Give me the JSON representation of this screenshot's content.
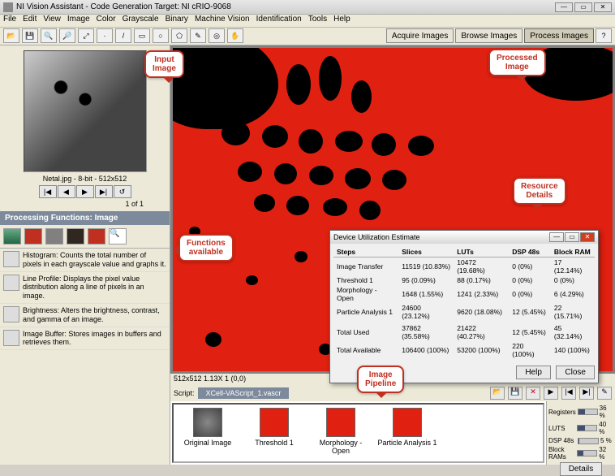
{
  "titlebar": {
    "title": "NI Vision Assistant - Code Generation Target: NI cRIO-9068"
  },
  "menubar": [
    "File",
    "Edit",
    "View",
    "Image",
    "Color",
    "Grayscale",
    "Binary",
    "Machine Vision",
    "Identification",
    "Tools",
    "Help"
  ],
  "top_tabs": {
    "acquire": "Acquire Images",
    "browse": "Browse Images",
    "process": "Process Images"
  },
  "thumb": {
    "caption": "Netal.jpg - 8-bit - 512x512",
    "count": "1 of 1"
  },
  "proc_header": "Processing Functions: Image",
  "functions": [
    {
      "icon": "hist",
      "text": "Histogram: Counts the total number of pixels in each grayscale value and graphs it."
    },
    {
      "icon": "line",
      "text": "Line Profile: Displays the pixel value distribution along a line of pixels in an image."
    },
    {
      "icon": "bright",
      "text": "Brightness: Alters the brightness, contrast, and gamma of an image."
    },
    {
      "icon": "buf",
      "text": "Image Buffer: Stores images in buffers and retrieves them."
    }
  ],
  "status": "512x512 1.13X 1 (0,0)",
  "script": "XCell-VAScript_1.vascr",
  "script_label": "Script:",
  "pipeline": [
    {
      "label": "Original Image",
      "cls": "orig"
    },
    {
      "label": "Threshold 1",
      "cls": ""
    },
    {
      "label": "Morphology - Open",
      "cls": ""
    },
    {
      "label": "Particle Analysis 1",
      "cls": ""
    }
  ],
  "callouts": {
    "input": "Input\nImage",
    "processed": "Processed\nImage",
    "functions": "Functions\navailable",
    "resource": "Resource\nDetails",
    "pipeline": "Image\nPipeline"
  },
  "util_dialog": {
    "title": "Device Utilization Estimate",
    "headers": [
      "Steps",
      "Slices",
      "LUTs",
      "DSP 48s",
      "Block RAM"
    ],
    "rows": [
      [
        "Image Transfer",
        "11519 (10.83%)",
        "10472 (19.68%)",
        "0 (0%)",
        "17 (12.14%)"
      ],
      [
        "Threshold 1",
        "95 (0.09%)",
        "88 (0.17%)",
        "0 (0%)",
        "0 (0%)"
      ],
      [
        "Morphology - Open",
        "1648 (1.55%)",
        "1241 (2.33%)",
        "0 (0%)",
        "6 (4.29%)"
      ],
      [
        "Particle Analysis 1",
        "24600 (23.12%)",
        "9620 (18.08%)",
        "12 (5.45%)",
        "22 (15.71%)"
      ]
    ],
    "totals": [
      [
        "Total Used",
        "37862 (35.58%)",
        "21422 (40.27%)",
        "12 (5.45%)",
        "45 (32.14%)"
      ],
      [
        "Total Available",
        "106400 (100%)",
        "53200 (100%)",
        "220 (100%)",
        "140 (100%)"
      ]
    ],
    "help": "Help",
    "close": "Close"
  },
  "resources": [
    {
      "label": "Registers",
      "pct": 36
    },
    {
      "label": "LUTS",
      "pct": 40
    },
    {
      "label": "DSP 48s",
      "pct": 5
    },
    {
      "label": "Block RAMs",
      "pct": 32
    }
  ],
  "details_btn": "Details"
}
